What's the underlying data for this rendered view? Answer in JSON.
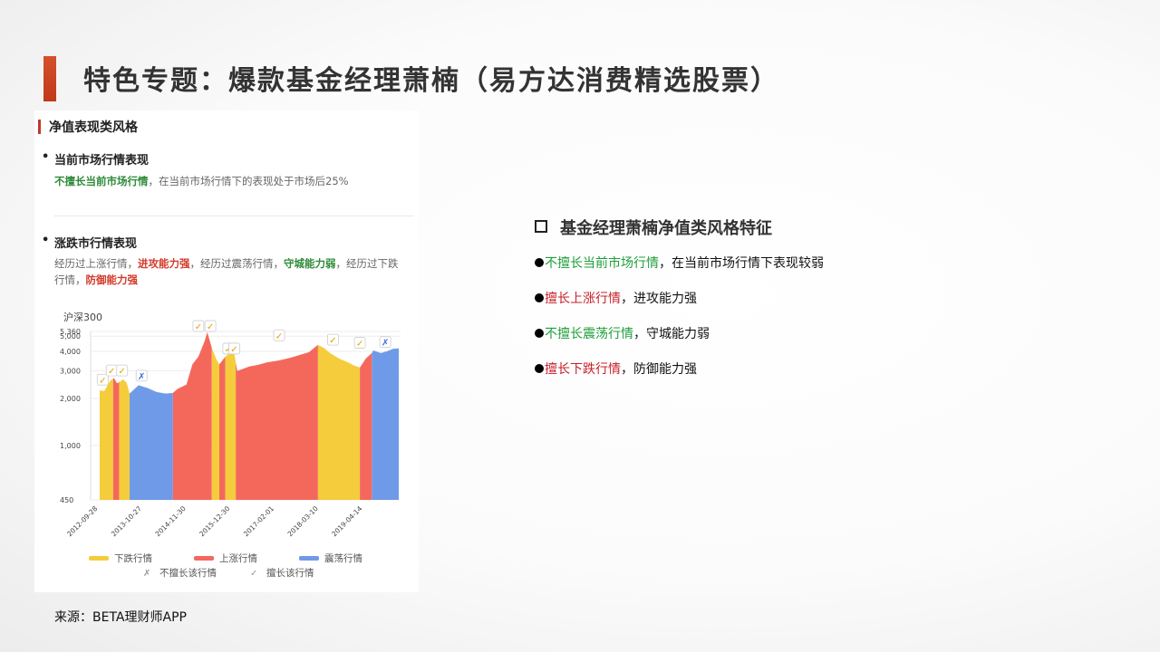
{
  "slide": {
    "title": "特色专题：爆款基金经理萧楠（易方达消费精选股票）",
    "source": "来源：BETA理财师APP"
  },
  "panel": {
    "header": "净值表现类风格",
    "section1": {
      "title": "当前市场行情表现",
      "highlight": "不擅长当前市场行情",
      "text": "，在当前市场行情下的表现处于市场后25%"
    },
    "section2": {
      "title": "涨跌市行情表现",
      "p1": "经历过上涨行情，",
      "p1_hl": "进攻能力强",
      "p2": "，经历过震荡行情，",
      "p2_hl": "守城能力弱",
      "p3": "，经历过下跌行情，",
      "p3_hl": "防御能力强"
    }
  },
  "chart_data": {
    "type": "area",
    "index_label": "沪深300",
    "y_ticks": [
      450,
      1000,
      2000,
      3000,
      4000,
      5000,
      5360
    ],
    "y_tick_labels": [
      "450",
      "1,000",
      "2,000",
      "3,000",
      "4,000",
      "5,000",
      "5,360"
    ],
    "y_scale": "log",
    "x_ticks": [
      "2012-09-28",
      "2013-10-27",
      "2014-11-30",
      "2015-12-30",
      "2017-02-01",
      "2018-03-10",
      "2019-04-14"
    ],
    "legend": {
      "down": "下跌行情",
      "up": "上涨行情",
      "flat": "震荡行情",
      "not_good": "不擅长该行情",
      "good": "擅长该行情"
    },
    "colors": {
      "down": "#f5cc3c",
      "up": "#f4685c",
      "flat": "#6f9ae8"
    }
  },
  "right": {
    "title": "基金经理萧楠净值类风格特征",
    "bullets": [
      {
        "hl": "不擅长当前市场行情",
        "rest": "，在当前市场行情下表现较弱",
        "color": "green"
      },
      {
        "hl": "擅长上涨行情",
        "rest": "，进攻能力强",
        "color": "red"
      },
      {
        "hl": "不擅长震荡行情",
        "rest": "，守城能力弱",
        "color": "green"
      },
      {
        "hl": "擅长下跌行情",
        "rest": "，防御能力强",
        "color": "red"
      }
    ]
  }
}
